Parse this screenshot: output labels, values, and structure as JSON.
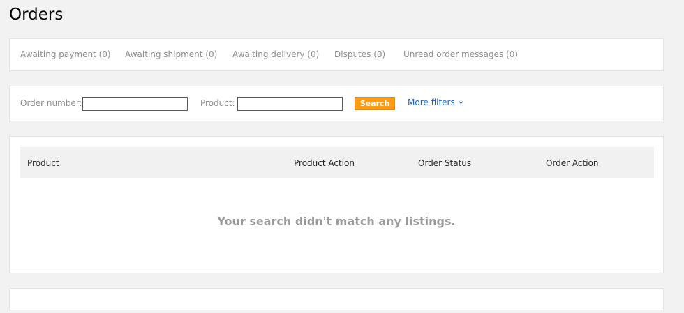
{
  "page": {
    "title": "Orders"
  },
  "tabs": [
    {
      "label": "Awaiting payment (0)"
    },
    {
      "label": "Awaiting shipment (0)"
    },
    {
      "label": "Awaiting delivery (0)"
    },
    {
      "label": "Disputes (0)"
    },
    {
      "label": "Unread order messages (0)"
    }
  ],
  "filters": {
    "order_number_label": "Order number:",
    "order_number_value": "",
    "product_label": "Product:",
    "product_value": "",
    "search_label": "Search",
    "more_filters_label": "More filters",
    "search_button_color": "#ff9c0f",
    "link_color": "#1a64b0"
  },
  "table": {
    "columns": [
      "Product",
      "Product Action",
      "Order Status",
      "Order Action"
    ],
    "empty_message": "Your search didn't match any listings."
  }
}
